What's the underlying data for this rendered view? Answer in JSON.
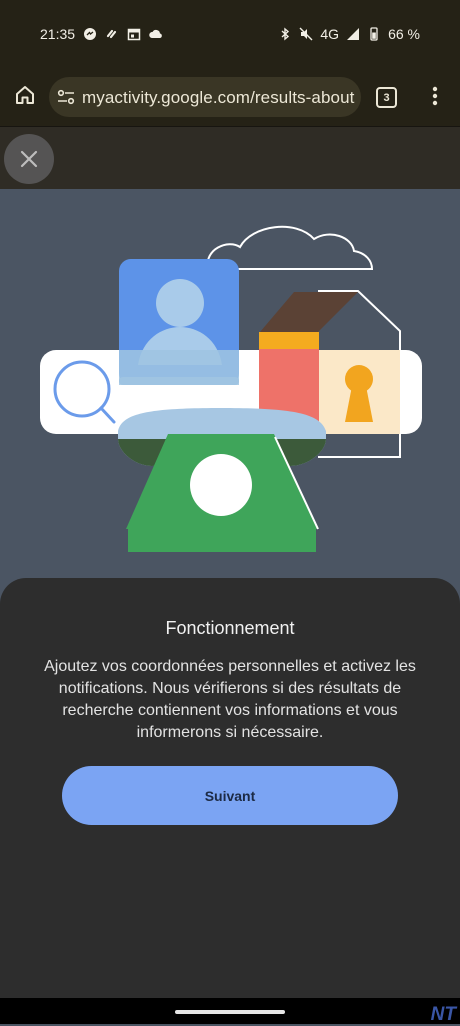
{
  "status_bar": {
    "time": "21:35",
    "network": "4G",
    "battery": "66 %",
    "icons": [
      "messenger-icon",
      "shazam-icon",
      "calendar-icon",
      "cloud-icon",
      "bluetooth-icon",
      "mute-icon",
      "signal-icon",
      "battery-icon"
    ]
  },
  "browser": {
    "url": "myactivity.google.com/results-about",
    "tab_count": "3",
    "icons": [
      "home-icon",
      "tune-icon",
      "tabs-icon",
      "more-vert-icon"
    ]
  },
  "overlay": {
    "close_icon": "close-icon"
  },
  "sheet": {
    "title": "Fonctionnement",
    "body": "Ajoutez vos coordonnées personnelles et activez les notifications. Nous vérifierons si des résultats de recherche contiennent vos informations et vous informerons si nécessaire.",
    "next_label": "Suivant"
  },
  "watermark": "NT",
  "colors": {
    "accent": "#7ba4f3",
    "sheet_bg": "#2d2d2d",
    "browser_bar": "#252216"
  }
}
